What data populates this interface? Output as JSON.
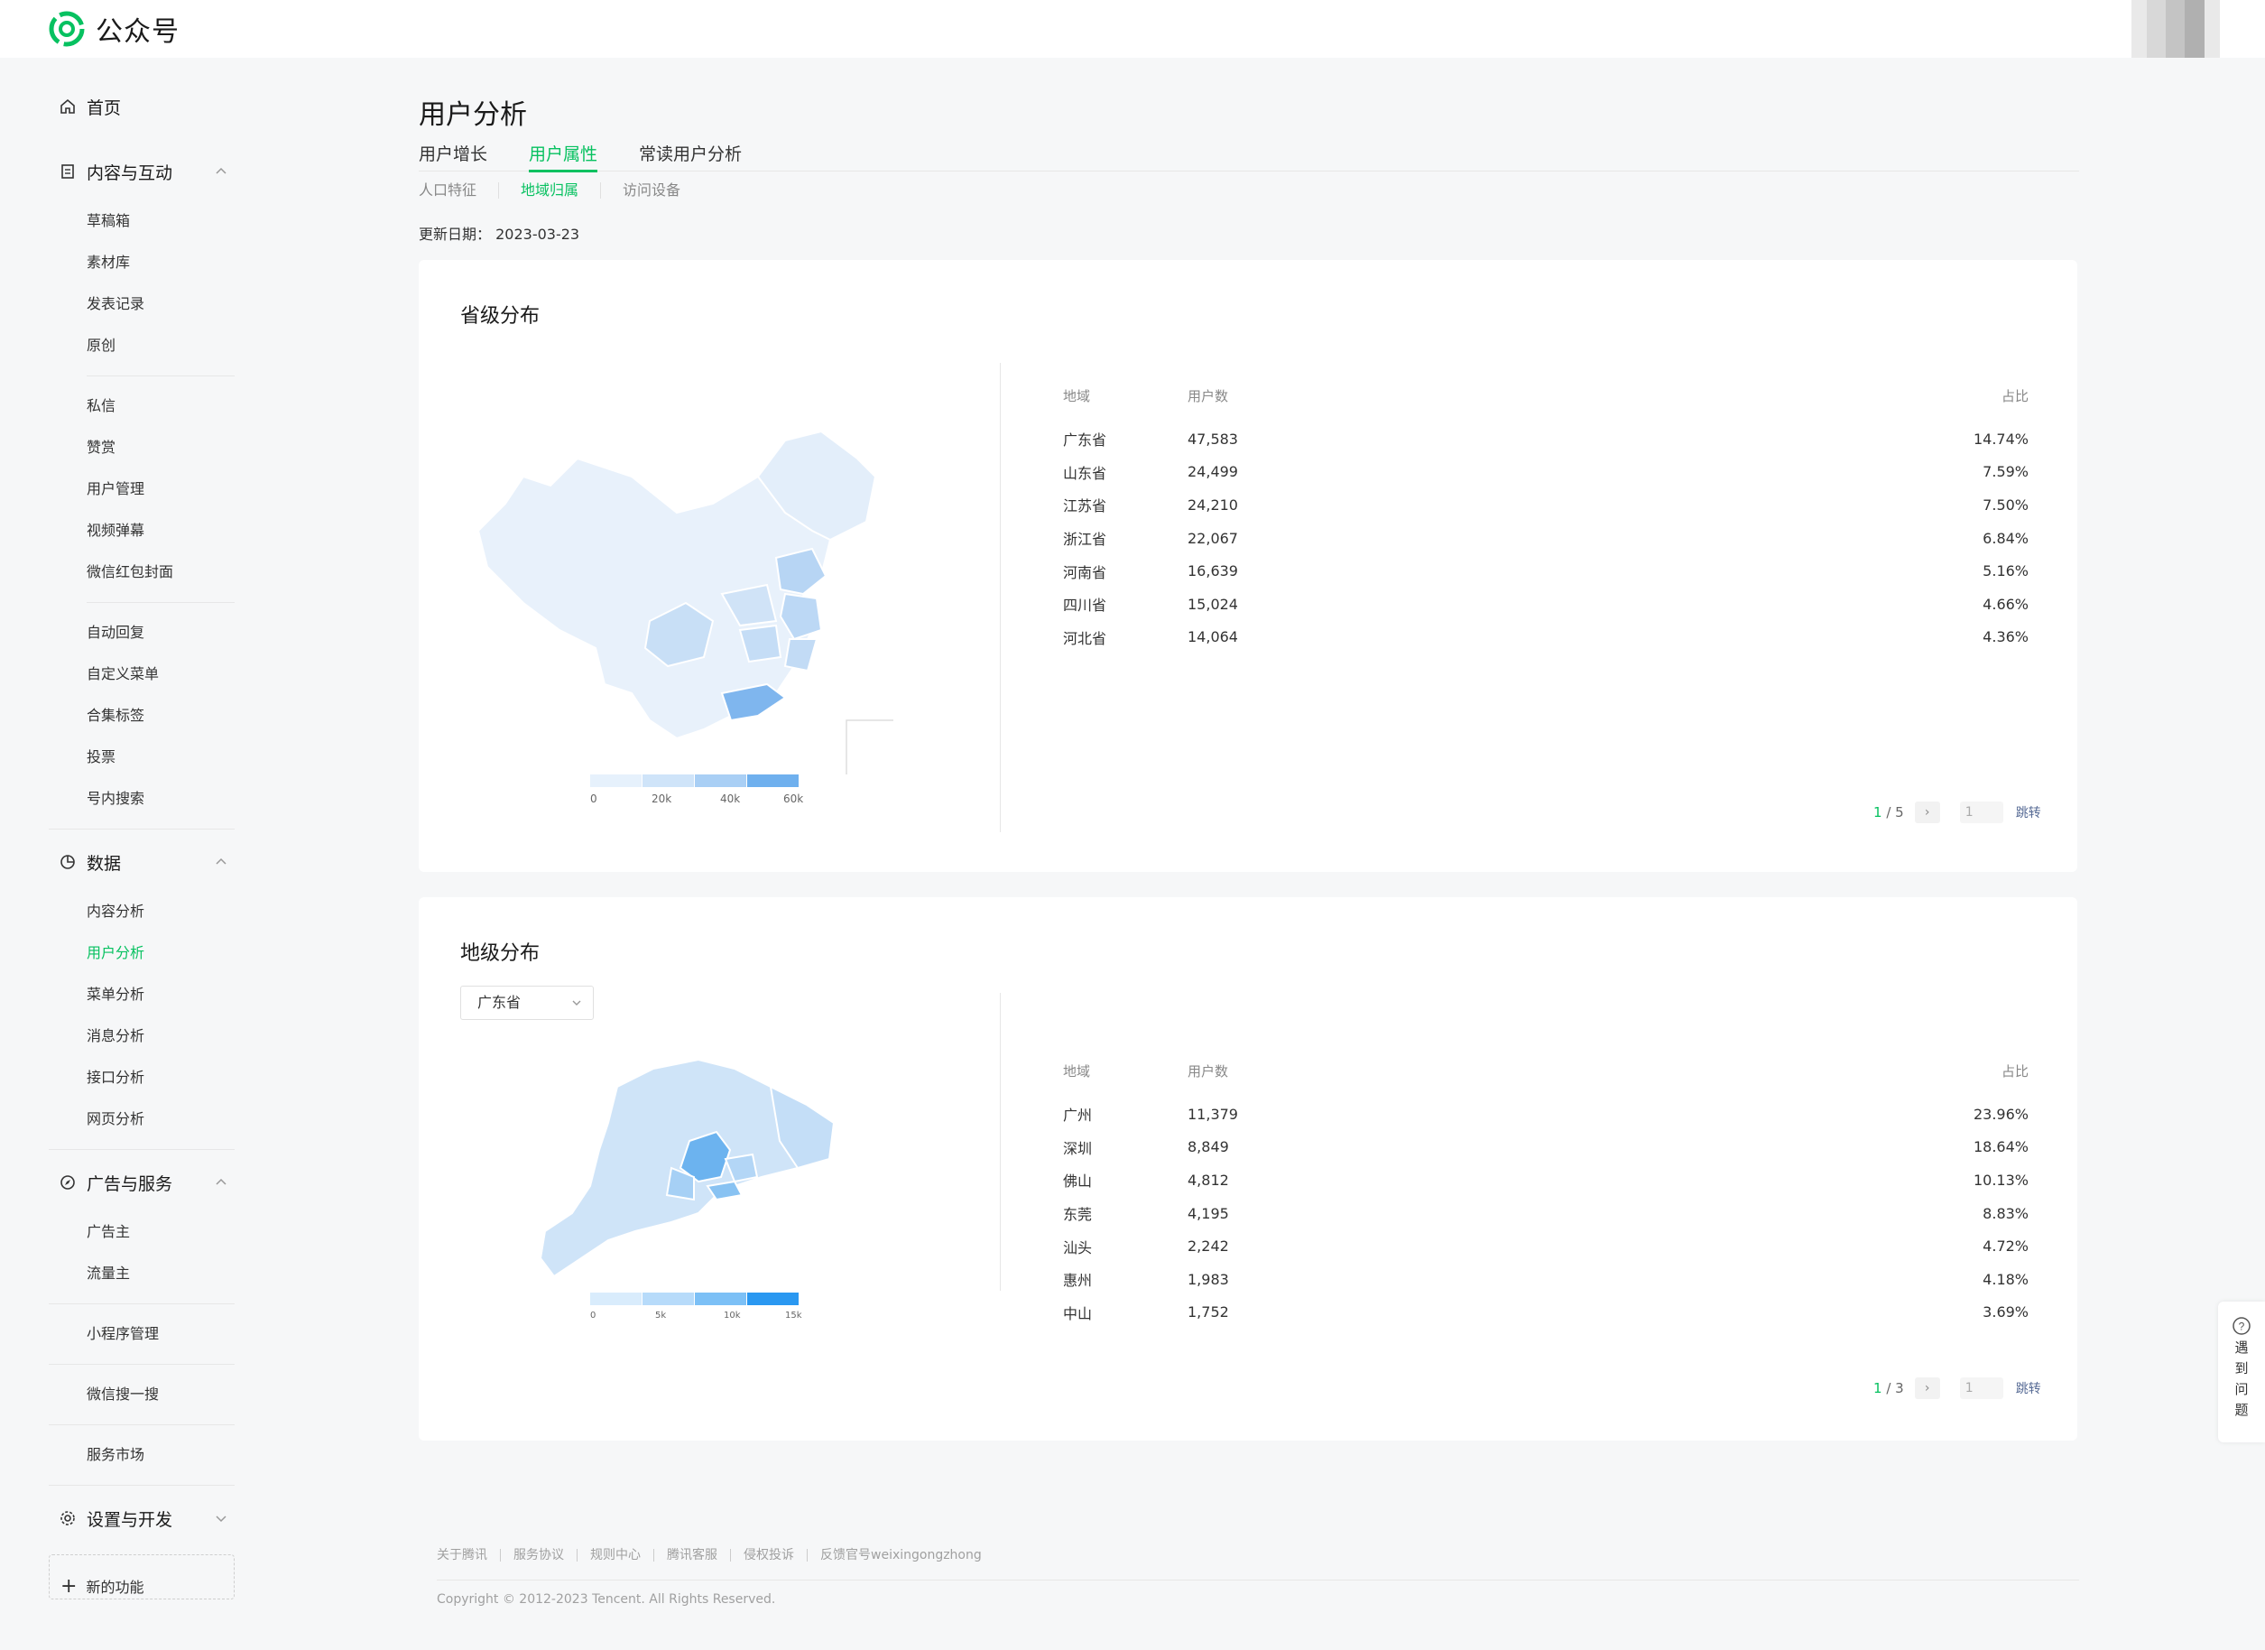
{
  "app": {
    "brand": "公众号"
  },
  "sidebar": {
    "home": "首页",
    "sections": [
      {
        "title": "内容与互动",
        "groups": [
          [
            "草稿箱",
            "素材库",
            "发表记录",
            "原创"
          ],
          [
            "私信",
            "赞赏",
            "用户管理",
            "视频弹幕",
            "微信红包封面"
          ],
          [
            "自动回复",
            "自定义菜单",
            "合集标签",
            "投票",
            "号内搜索"
          ]
        ]
      },
      {
        "title": "数据",
        "items": [
          "内容分析",
          "用户分析",
          "菜单分析",
          "消息分析",
          "接口分析",
          "网页分析"
        ]
      },
      {
        "title": "广告与服务",
        "items": [
          "广告主",
          "流量主"
        ]
      },
      {
        "standalone": [
          "小程序管理",
          "微信搜一搜",
          "服务市场"
        ]
      },
      {
        "title": "设置与开发"
      }
    ],
    "new_func": "新的功能"
  },
  "page": {
    "title": "用户分析",
    "tabs": [
      "用户增长",
      "用户属性",
      "常读用户分析"
    ],
    "subtabs": [
      "人口特征",
      "地域归属",
      "访问设备"
    ],
    "update_label": "更新日期：",
    "update_date": "2023-03-23"
  },
  "province": {
    "title": "省级分布",
    "headers": [
      "地域",
      "用户数",
      "占比"
    ],
    "rows": [
      [
        "广东省",
        "47,583",
        "14.74%"
      ],
      [
        "山东省",
        "24,499",
        "7.59%"
      ],
      [
        "江苏省",
        "24,210",
        "7.50%"
      ],
      [
        "浙江省",
        "22,067",
        "6.84%"
      ],
      [
        "河南省",
        "16,639",
        "5.16%"
      ],
      [
        "四川省",
        "15,024",
        "4.66%"
      ],
      [
        "河北省",
        "14,064",
        "4.36%"
      ]
    ],
    "legend": [
      "0",
      "20k",
      "40k",
      "60k"
    ],
    "legend_colors": [
      "#e6f1fc",
      "#cfe4f9",
      "#a9cff5",
      "#6fb0ee"
    ],
    "pager": {
      "current": "1",
      "total": "5",
      "input": "1",
      "jump": "跳转"
    }
  },
  "city": {
    "title": "地级分布",
    "select": "广东省",
    "headers": [
      "地域",
      "用户数",
      "占比"
    ],
    "rows": [
      [
        "广州",
        "11,379",
        "23.96%"
      ],
      [
        "深圳",
        "8,849",
        "18.64%"
      ],
      [
        "佛山",
        "4,812",
        "10.13%"
      ],
      [
        "东莞",
        "4,195",
        "8.83%"
      ],
      [
        "汕头",
        "2,242",
        "4.72%"
      ],
      [
        "惠州",
        "1,983",
        "4.18%"
      ],
      [
        "中山",
        "1,752",
        "3.69%"
      ]
    ],
    "legend": [
      "0",
      "5k",
      "10k",
      "15k"
    ],
    "legend_colors": [
      "#d9ecfc",
      "#b7dbfa",
      "#7cc0f6",
      "#2a98f1"
    ],
    "pager": {
      "current": "1",
      "total": "3",
      "input": "1",
      "jump": "跳转"
    }
  },
  "footer": {
    "links": [
      "关于腾讯",
      "服务协议",
      "规则中心",
      "腾讯客服",
      "侵权投诉",
      "反馈官号weixingongzhong"
    ],
    "copyright": "Copyright © 2012-2023 Tencent. All Rights Reserved."
  },
  "help": {
    "chars": [
      "遇",
      "到",
      "问",
      "题"
    ]
  },
  "colors": {
    "accent": "#07c160",
    "link": "#576b95"
  }
}
